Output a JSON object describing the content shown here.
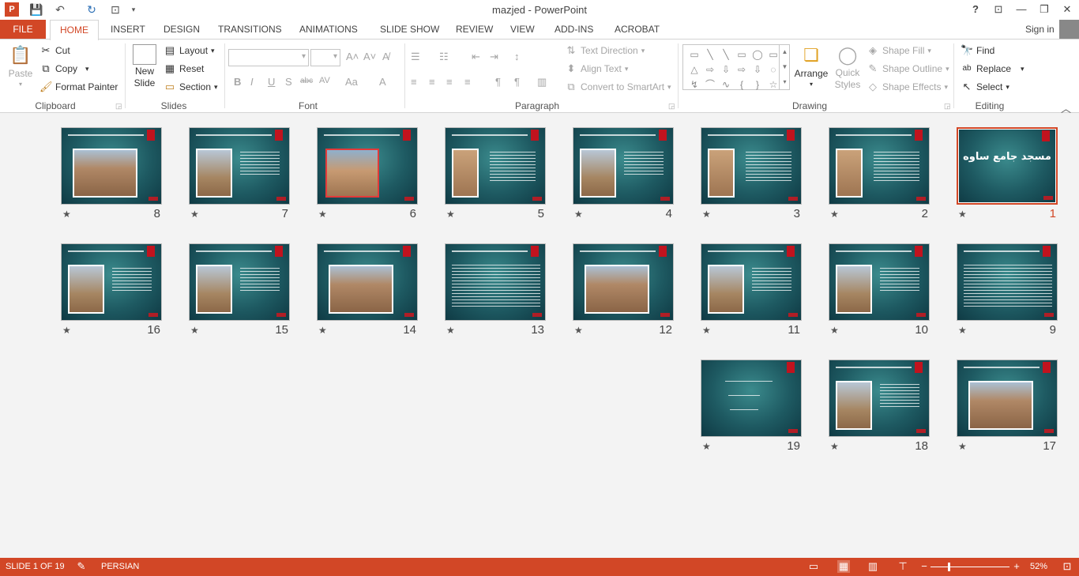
{
  "app": {
    "title": "mazjed - PowerPoint",
    "accent": "#d24726"
  },
  "quick_access": [
    {
      "name": "app-logo-icon",
      "glyph": "P"
    },
    {
      "name": "save-icon",
      "glyph": "💾"
    },
    {
      "name": "undo-icon",
      "glyph": "↶"
    },
    {
      "name": "redo-icon",
      "glyph": "↻"
    },
    {
      "name": "presenter-icon",
      "glyph": "⊡"
    },
    {
      "name": "customize-icon",
      "glyph": "▾"
    }
  ],
  "window_controls": {
    "help": "?",
    "ribbon_options": "⊡",
    "minimize": "—",
    "restore": "❐",
    "close": "✕"
  },
  "tabs": {
    "file": "FILE",
    "items": [
      "HOME",
      "INSERT",
      "DESIGN",
      "TRANSITIONS",
      "ANIMATIONS",
      "SLIDE SHOW",
      "REVIEW",
      "VIEW",
      "ADD-INS",
      "ACROBAT"
    ],
    "active": "HOME"
  },
  "signin": "Sign in",
  "ribbon": {
    "clipboard": {
      "label": "Clipboard",
      "paste": "Paste",
      "cut": "Cut",
      "copy": "Copy",
      "format_painter": "Format Painter"
    },
    "slides": {
      "label": "Slides",
      "new_slide_1": "New",
      "new_slide_2": "Slide",
      "layout": "Layout",
      "reset": "Reset",
      "section": "Section"
    },
    "font": {
      "label": "Font"
    },
    "paragraph": {
      "label": "Paragraph",
      "text_direction": "Text Direction",
      "align_text": "Align Text",
      "convert_smartart": "Convert to SmartArt"
    },
    "drawing": {
      "label": "Drawing",
      "arrange": "Arrange",
      "quick_styles_1": "Quick",
      "quick_styles_2": "Styles",
      "shape_fill": "Shape Fill",
      "shape_outline": "Shape Outline",
      "shape_effects": "Shape Effects",
      "shapes": [
        "▭",
        "╲",
        "╲",
        "▭",
        "◯",
        "▭",
        "△",
        "⇨",
        "⇩",
        "⇨",
        "⇩",
        "◌",
        "↯",
        "⌒",
        "∿",
        "{",
        "}",
        "☆"
      ]
    },
    "editing": {
      "label": "Editing",
      "find": "Find",
      "replace": "Replace",
      "select": "Select"
    }
  },
  "slides": [
    {
      "num": "1",
      "layout": "title",
      "selected": true,
      "title_text": "مسجد جامع ساوه"
    },
    {
      "num": "2",
      "layout": "photo-left-tall",
      "selected": false
    },
    {
      "num": "3",
      "layout": "photo-left-tall",
      "selected": false
    },
    {
      "num": "4",
      "layout": "photo-left",
      "selected": false
    },
    {
      "num": "5",
      "layout": "photo-left-tall",
      "selected": false
    },
    {
      "num": "6",
      "layout": "photo-center-red",
      "selected": false
    },
    {
      "num": "7",
      "layout": "photo-left",
      "selected": false
    },
    {
      "num": "8",
      "layout": "photo-center",
      "selected": false
    },
    {
      "num": "9",
      "layout": "text-only",
      "selected": false
    },
    {
      "num": "10",
      "layout": "photo-left",
      "selected": false
    },
    {
      "num": "11",
      "layout": "photo-left",
      "selected": false
    },
    {
      "num": "12",
      "layout": "photo-center",
      "selected": false
    },
    {
      "num": "13",
      "layout": "text-only",
      "selected": false
    },
    {
      "num": "14",
      "layout": "photo-center",
      "selected": false
    },
    {
      "num": "15",
      "layout": "photo-left",
      "selected": false
    },
    {
      "num": "16",
      "layout": "photo-left",
      "selected": false
    },
    {
      "num": "17",
      "layout": "photo-center",
      "selected": false
    },
    {
      "num": "18",
      "layout": "photo-left",
      "selected": false
    },
    {
      "num": "19",
      "layout": "calligraphy",
      "selected": false
    }
  ],
  "status": {
    "slide": "SLIDE 1 OF 19",
    "language": "PERSIAN",
    "zoom": "52%",
    "zoom_level": 0.52
  }
}
